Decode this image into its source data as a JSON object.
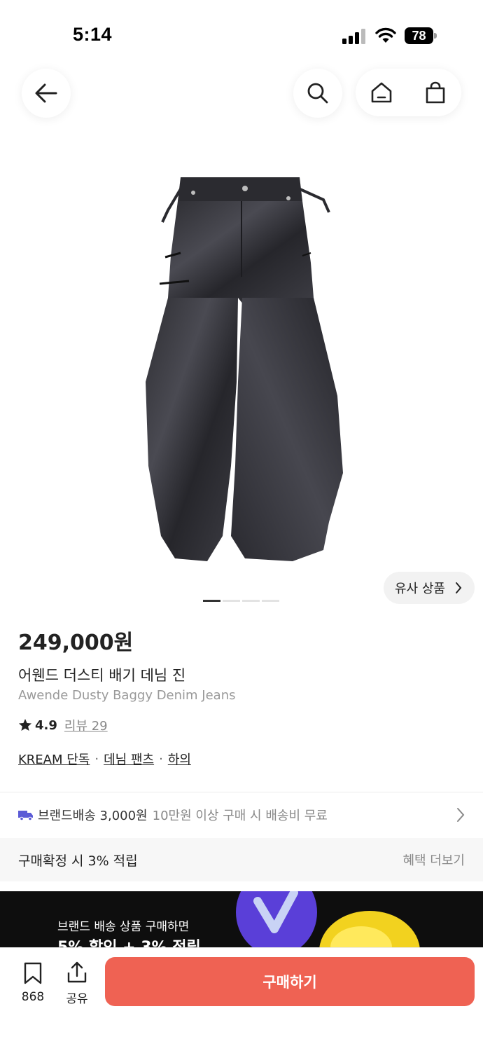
{
  "status": {
    "time": "5:14",
    "battery": "78"
  },
  "nav": {
    "back_icon": "arrow-left-icon",
    "search_icon": "search-icon",
    "home_icon": "home-icon",
    "cart_icon": "shopping-bag-icon"
  },
  "gallery": {
    "similar_label": "유사 상품",
    "total_images": 4,
    "active_index": 0
  },
  "product": {
    "price": "249,000원",
    "name_ko": "어웬드 더스티 배기 데님 진",
    "name_en": "Awende Dusty Baggy Denim Jeans",
    "rating": "4.9",
    "review_label": "리뷰 29",
    "tags": [
      "KREAM 단독",
      "데님 팬츠",
      "하의"
    ],
    "tag_separator": "·"
  },
  "shipping": {
    "icon": "truck-icon",
    "label": "브랜드배송 3,000원",
    "note": "10만원 이상 구매 시 배송비 무료"
  },
  "points": {
    "label": "구매확정 시 3% 적립",
    "more": "혜택 더보기"
  },
  "banner": {
    "line1": "브랜드 배송 상품 구매하면",
    "line2": "5% 할인 + 3% 적립"
  },
  "bottom": {
    "wish_count": "868",
    "share_label": "공유",
    "buy_label": "구매하기"
  },
  "colors": {
    "accent": "#ef6253",
    "shipping_icon": "#5b5bd6",
    "banner_bg": "#0e0e0e"
  }
}
